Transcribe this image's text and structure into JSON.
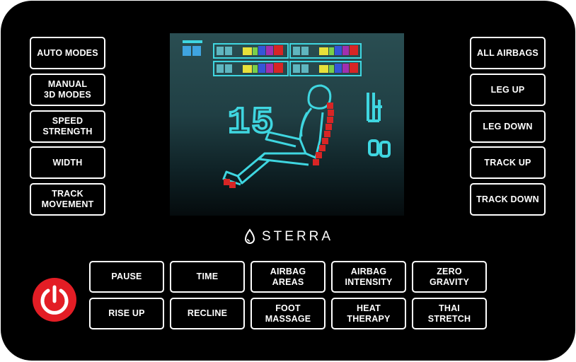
{
  "brand": {
    "name": "STERRA",
    "icon": "droplet-icon"
  },
  "colors": {
    "panel": "#000000",
    "power": "#e31d25",
    "screen_accent": "#3fd6e0",
    "screen_red": "#d82525"
  },
  "left_buttons": {
    "auto_modes": "AUTO MODES",
    "manual_3d_modes": "MANUAL\n3D MODES",
    "speed_strength": "SPEED\nSTRENGTH",
    "width": "WIDTH",
    "track_movement": "TRACK\nMOVEMENT"
  },
  "right_buttons": {
    "all_airbags": "ALL AIRBAGS",
    "leg_up": "LEG UP",
    "leg_down": "LEG DOWN",
    "track_up": "TRACK UP",
    "track_down": "TRACK DOWN"
  },
  "bottom_buttons": {
    "pause": "PAUSE",
    "time": "TIME",
    "airbag_areas": "AIRBAG\nAREAS",
    "airbag_intensity": "AIRBAG\nINTENSITY",
    "zero_gravity": "ZERO\nGRAVITY",
    "rise_up": "RISE UP",
    "recline": "RECLINE",
    "foot_massage": "FOOT\nMASSAGE",
    "heat_therapy": "HEAT\nTHERAPY",
    "thai_stretch": "THAI\nSTRETCH"
  },
  "display": {
    "timer_value": "15",
    "power_icon": "power-icon",
    "chair_icon": "reclined-person-icon"
  }
}
